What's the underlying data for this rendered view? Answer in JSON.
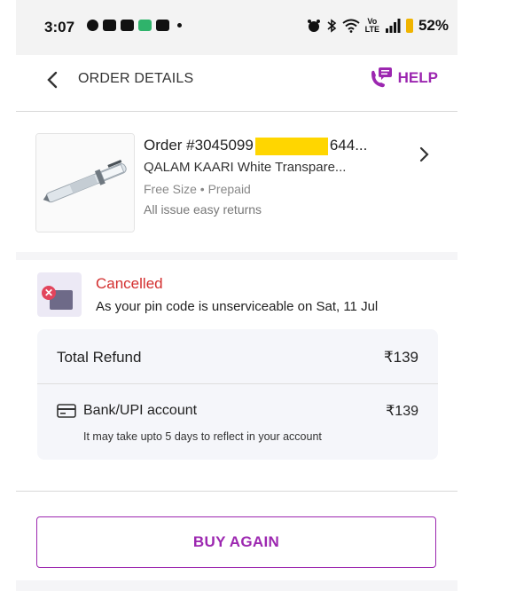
{
  "status_bar": {
    "time": "3:07",
    "battery": "52%",
    "lte_top": "Vo",
    "lte_bottom": "LTE"
  },
  "header": {
    "title": "ORDER DETAILS",
    "help_label": "HELP"
  },
  "product": {
    "order_prefix": "Order #3045099",
    "order_suffix": "644...",
    "name": "QALAM KAARI White Transpare...",
    "meta": "Free Size • Prepaid",
    "returns": "All issue easy returns"
  },
  "cancellation": {
    "status": "Cancelled",
    "note": "As your pin code is unserviceable on Sat, 11 Jul"
  },
  "refund": {
    "total_label": "Total Refund",
    "total_amount": "₹139",
    "method_label": "Bank/UPI account",
    "method_amount": "₹139",
    "note": "It may take upto 5 days to reflect in your account"
  },
  "actions": {
    "buy_again": "BUY AGAIN"
  },
  "colors": {
    "accent": "#9c27b0",
    "cancel_red": "#d32f2f",
    "mask_yellow": "#ffd600"
  }
}
